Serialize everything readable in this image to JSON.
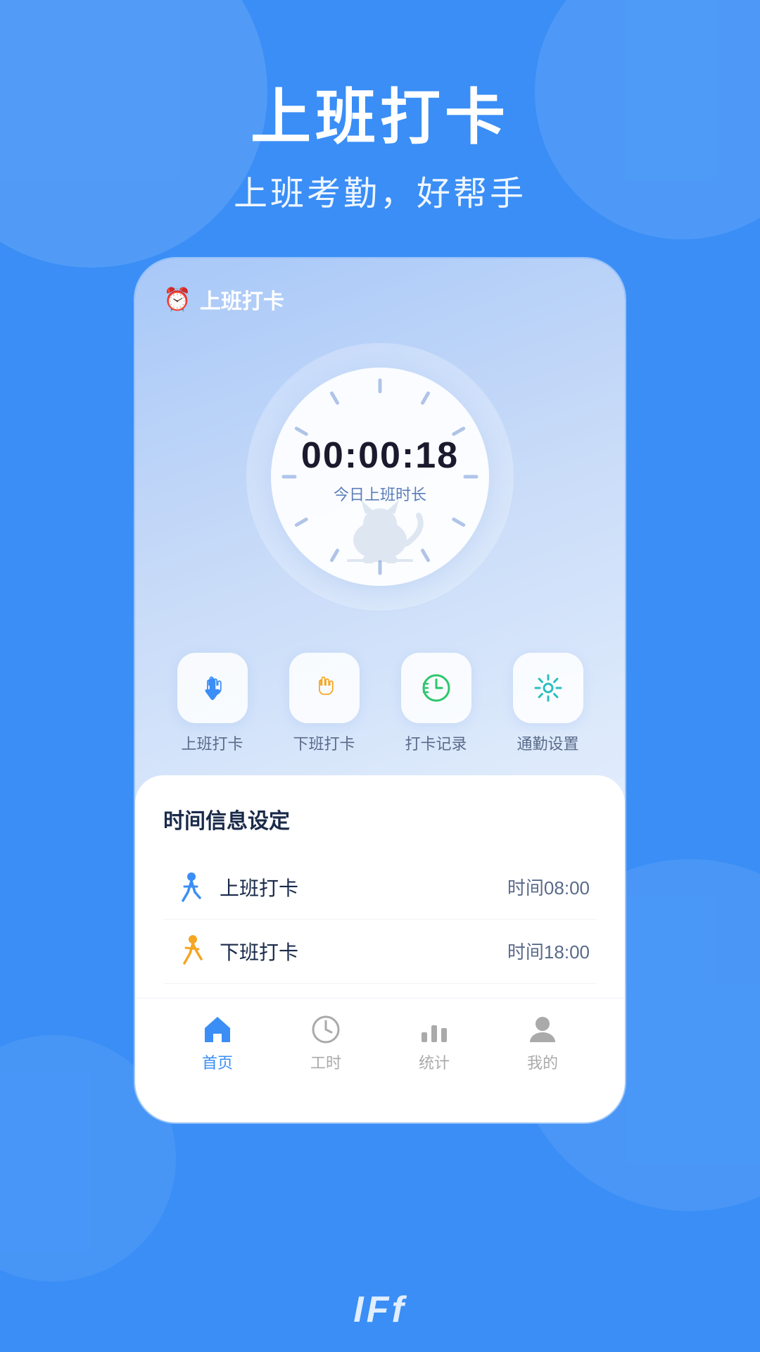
{
  "app": {
    "title": "上班打卡",
    "subtitle": "上班考勤，好帮手",
    "brand_icon": "⏰"
  },
  "phone": {
    "topbar_app_name": "上班打卡"
  },
  "clock": {
    "time": "00:00:18",
    "label": "今日上班时长"
  },
  "actions": [
    {
      "id": "checkin",
      "label": "上班打卡",
      "color": "#3a8ef6"
    },
    {
      "id": "checkout",
      "label": "下班打卡",
      "color": "#f5a623"
    },
    {
      "id": "records",
      "label": "打卡记录",
      "color": "#2dc76d"
    },
    {
      "id": "settings",
      "label": "通勤设置",
      "color": "#2bbfbf"
    }
  ],
  "schedule_section_title": "时间信息设定",
  "schedule_items": [
    {
      "id": "morning",
      "name": "上班打卡",
      "time": "时间08:00",
      "icon_color": "#3a8ef6"
    },
    {
      "id": "evening",
      "name": "下班打卡",
      "time": "时间18:00",
      "icon_color": "#f5a623"
    }
  ],
  "nav_items": [
    {
      "id": "home",
      "label": "首页",
      "active": true
    },
    {
      "id": "hours",
      "label": "工时",
      "active": false
    },
    {
      "id": "stats",
      "label": "统计",
      "active": false
    },
    {
      "id": "me",
      "label": "我的",
      "active": false
    }
  ],
  "watermark": "IFf"
}
